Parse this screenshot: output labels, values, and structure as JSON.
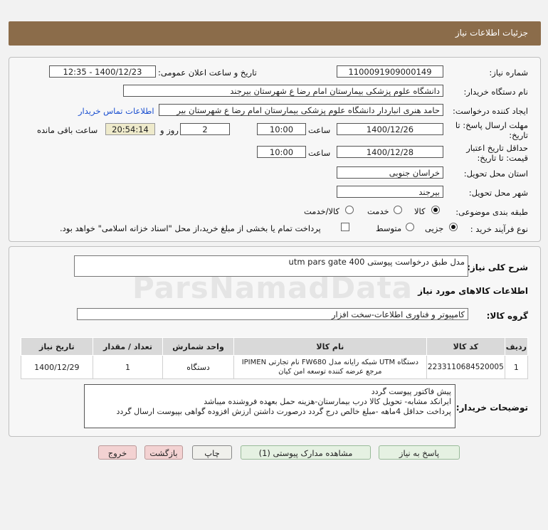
{
  "header": {
    "title": "جزئیات اطلاعات نیاز"
  },
  "form": {
    "need_number_label": "شماره نیاز:",
    "need_number": "1100091909000149",
    "announce_label": "تاریخ و ساعت اعلان عمومی:",
    "announce_value": "1400/12/23 - 12:35",
    "buyer_label": "نام دستگاه خریدار:",
    "buyer_value": "دانشگاه علوم پزشکی  بیمارستان امام رضا ع  شهرستان بیرجند",
    "creator_label": "ایجاد کننده درخواست:",
    "creator_value": "حامد هنری انباردار دانشگاه علوم پزشکی  بیمارستان امام رضا ع  شهرستان بیر",
    "contact_link": "اطلاعات تماس خریدار",
    "deadline_label_1": "مهلت ارسال پاسخ: تا",
    "deadline_label_2": "تاریخ:",
    "deadline_date": "1400/12/26",
    "time_label": "ساعت",
    "deadline_time": "10:00",
    "days_value": "2",
    "days_label": "روز و",
    "remaining_time": "20:54:14",
    "remaining_label": "ساعت باقی مانده",
    "validity_label_1": "حداقل تاریخ اعتبار",
    "validity_label_2": "قیمت: تا تاریخ:",
    "validity_date": "1400/12/28",
    "validity_time": "10:00",
    "province_label": "استان محل تحویل:",
    "province_value": "خراسان جنوبی",
    "city_label": "شهر محل تحویل:",
    "city_value": "بیرجند",
    "category_label": "طبقه بندی موضوعی:",
    "category_options": [
      "کالا",
      "خدمت",
      "کالا/خدمت"
    ],
    "process_label": "نوع فرآیند خرید :",
    "process_options": [
      "جزیی",
      "متوسط"
    ],
    "process_note": "پرداخت تمام یا بخشی از مبلغ خرید،از محل \"اسناد خزانه اسلامی\" خواهد بود."
  },
  "details": {
    "summary_label": "شرح کلی نیاز:",
    "summary_value": "مدل طبق درخواست پیوستی utm pars  gate 400",
    "goods_info_title": "اطلاعات کالاهای مورد نیاز",
    "group_label": "گروه کالا:",
    "group_value": "کامپیوتر و فناوری اطلاعات-سخت افزار",
    "table": {
      "headers": [
        "ردیف",
        "کد کالا",
        "نام کالا",
        "واحد شمارش",
        "تعداد / مقدار",
        "تاریخ نیاز"
      ],
      "rows": [
        {
          "row": "1",
          "code": "2233110684520005",
          "name_line1": "دستگاه UTM شبکه رایانه مدل FW680 نام تجارتی IPIMEN",
          "name_line2": "مرجع عرضه کننده توسعه امن کیان",
          "unit": "دستگاه",
          "qty": "1",
          "date": "1400/12/29"
        }
      ]
    },
    "buyer_notes_label": "توضیحات خریدار:",
    "buyer_notes": [
      "پیش فاکتور پیوست گردد",
      "ایرانکد مشابه- تحویل کالا درب بیمارستان-هزینه حمل بعهده فروشنده میباشد",
      "پرداخت حداقل 4ماهه -مبلغ خالص درج گردد درصورت داشتن ارزش افزوده گواهی بپیوست ارسال گردد"
    ]
  },
  "buttons": {
    "reply": "پاسخ به نیاز",
    "attachments": "مشاهده مدارک پیوستی (1)",
    "print": "چاپ",
    "back": "بازگشت",
    "exit": "خروج"
  }
}
